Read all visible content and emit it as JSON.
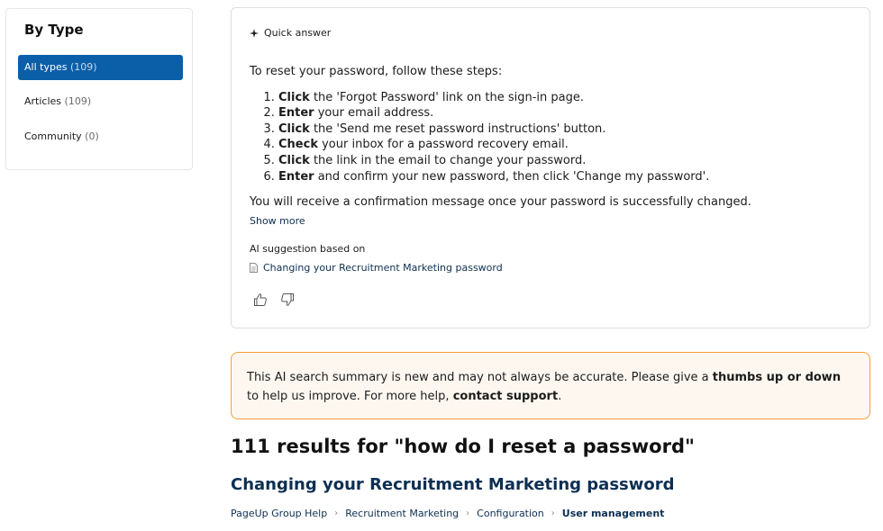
{
  "sidebar": {
    "title": "By Type",
    "items": [
      {
        "label": "All types",
        "count": "(109)"
      },
      {
        "label": "Articles",
        "count": "(109)"
      },
      {
        "label": "Community",
        "count": "(0)"
      }
    ]
  },
  "quick_answer": {
    "header": "Quick answer",
    "intro": "To reset your password, follow these steps:",
    "steps": [
      {
        "bold": "Click",
        "text": " the 'Forgot Password' link on the sign-in page."
      },
      {
        "bold": "Enter",
        "text": " your email address."
      },
      {
        "bold": "Click",
        "text": " the 'Send me reset password instructions' button."
      },
      {
        "bold": "Check",
        "text": " your inbox for a password recovery email."
      },
      {
        "bold": "Click",
        "text": " the link in the email to change your password."
      },
      {
        "bold": "Enter",
        "text": " and confirm your new password, then click 'Change my password'."
      }
    ],
    "outro": "You will receive a confirmation message once your password is successfully changed.",
    "show_more": "Show more",
    "ai_label": "AI suggestion based on",
    "source": "Changing your Recruitment Marketing password"
  },
  "notice": {
    "text_before": "This AI search summary is new and may not always be accurate. Please give a ",
    "bold": "thumbs up or down",
    "text_middle": " to help us improve. For more help, ",
    "link": "contact support",
    "text_after": "."
  },
  "results": {
    "heading": "111 results for \"how do I reset a password\"",
    "first_title": "Changing your Recruitment Marketing password",
    "breadcrumb": [
      "PageUp Group Help",
      "Recruitment Marketing",
      "Configuration",
      "User management"
    ]
  },
  "icons": {
    "sparkle": "sparkle-icon",
    "document": "document-icon",
    "thumbs_up": "thumbs-up-icon",
    "thumbs_down": "thumbs-down-icon",
    "breadcrumb_separator": "chevron-right-icon"
  },
  "colors": {
    "accent": "#0b5ea8",
    "link": "#0d2f52",
    "notice_border": "#f0a23a",
    "notice_bg": "#fdf7f0"
  }
}
